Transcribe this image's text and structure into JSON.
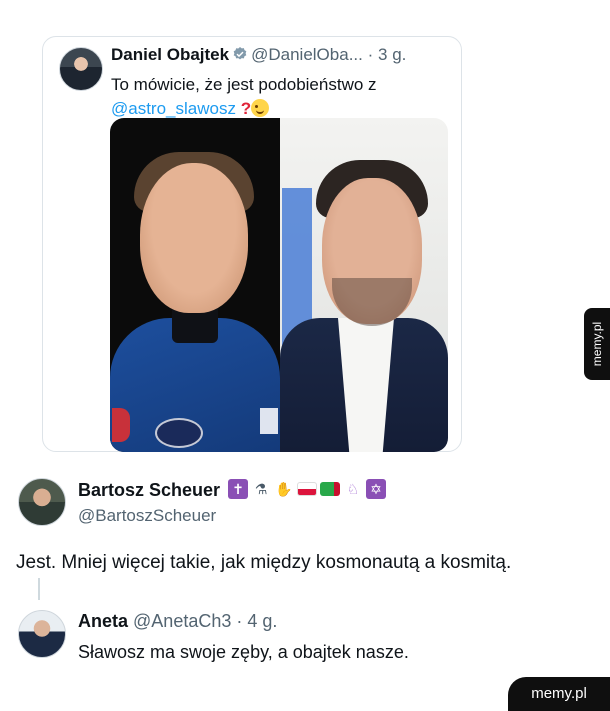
{
  "quoted_tweet": {
    "author_name": "Daniel Obajtek",
    "handle": "@DanielOba...",
    "separator": "·",
    "time": "3 g.",
    "text_before": "To mówicie, że jest podobieństwo z",
    "mention": "@astro_slawosz",
    "icons": [
      "verified-icon",
      "question-mark-icon",
      "wink-icon",
      "more-icon"
    ]
  },
  "reply_1": {
    "author_name": "Bartosz Scheuer",
    "handle": "@BartoszScheuer",
    "name_emojis": [
      "cross-icon",
      "microscope-icon",
      "hand-icon",
      "poland-flag-icon",
      "turkmenistan-flag-icon",
      "unicorn-icon",
      "star-of-david-icon"
    ],
    "text": "Jest. Mniej więcej takie, jak między kosmonautą a kosmitą."
  },
  "reply_2": {
    "author_name": "Aneta",
    "meta": "@AnetaCh3 · 4 g.",
    "text": "Sławosz ma swoje zęby,  a obajtek nasze."
  },
  "watermark": {
    "side": "memy.pl",
    "bottom": "memy.pl"
  },
  "colors": {
    "link": "#1d9bf0",
    "secondary_text": "#536471",
    "verified": "#829aab"
  }
}
